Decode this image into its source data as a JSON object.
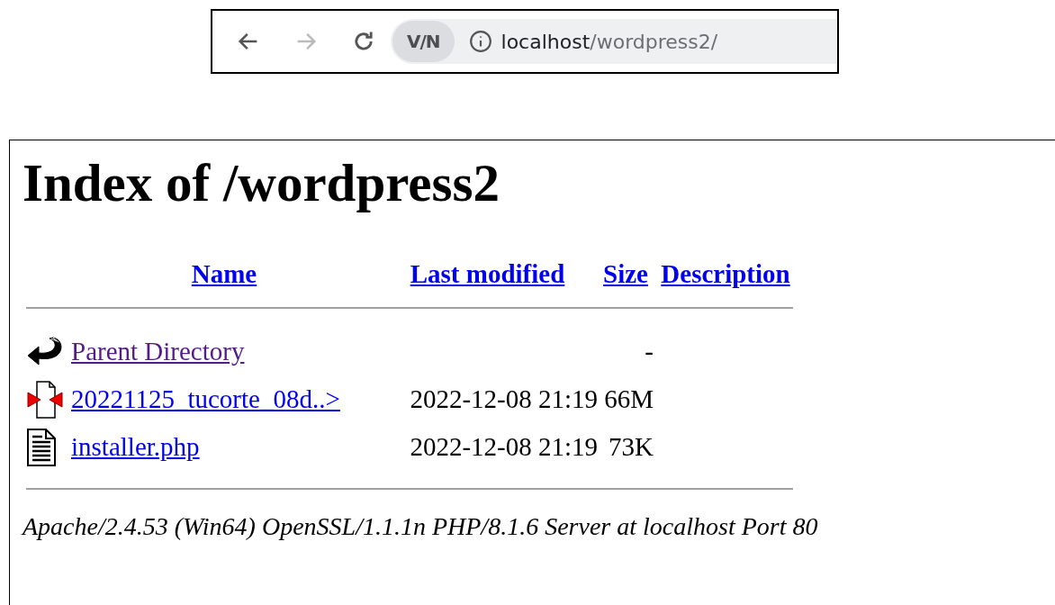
{
  "browser_bar": {
    "back_disabled": false,
    "forward_disabled": true,
    "vpn_badge": "V/N",
    "url_host": "localhost",
    "url_path": "/wordpress2/"
  },
  "heading": "Index of /wordpress2",
  "table": {
    "columns": [
      "Name",
      "Last modified",
      "Size",
      "Description"
    ],
    "rows": [
      {
        "kind": "parent",
        "name": "Parent Directory",
        "visited": true,
        "modified": "",
        "size": "-"
      },
      {
        "kind": "archive",
        "name": "20221125_tucorte_08d..>",
        "visited": false,
        "modified": "2022-12-08 21:19",
        "size": "66M"
      },
      {
        "kind": "text",
        "name": "installer.php",
        "visited": false,
        "modified": "2022-12-08 21:19",
        "size": "73K"
      }
    ]
  },
  "footer": "Apache/2.4.53 (Win64) OpenSSL/1.1.1n PHP/8.1.6 Server at localhost Port 80"
}
